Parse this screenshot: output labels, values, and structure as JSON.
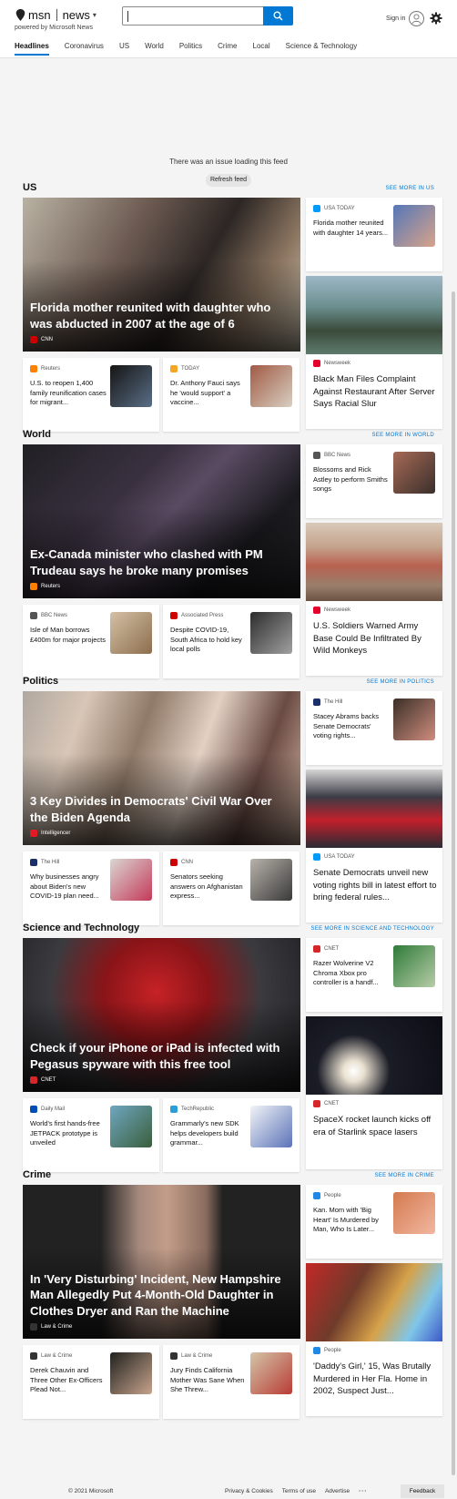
{
  "header": {
    "brand": "msn",
    "section": "news",
    "powered_by": "powered by Microsoft News",
    "search_value": "",
    "sign_in": "Sign in"
  },
  "nav": {
    "tabs": [
      {
        "label": "Headlines",
        "active": true
      },
      {
        "label": "Coronavirus"
      },
      {
        "label": "US"
      },
      {
        "label": "World"
      },
      {
        "label": "Politics"
      },
      {
        "label": "Crime"
      },
      {
        "label": "Local"
      },
      {
        "label": "Science & Technology"
      }
    ]
  },
  "feed_error": {
    "message": "There was an issue loading this feed",
    "refresh_label": "Refresh feed"
  },
  "sections": [
    {
      "title": "US",
      "see_more": "SEE MORE IN US",
      "hero": {
        "title": "Florida mother reunited with daughter who was abducted in 2007 at the age of 6",
        "source": "CNN"
      },
      "small_cards": [
        {
          "source": "Reuters",
          "title": "U.S. to reopen 1,400 family reunification cases for migrant..."
        },
        {
          "source": "TODAY",
          "title": "Dr. Anthony Fauci says he 'would support' a vaccine..."
        }
      ],
      "right_top": {
        "source": "USA TODAY",
        "title": "Florida mother reunited with daughter 14 years..."
      },
      "right_tall": {
        "source": "Newsweek",
        "title": "Black Man Files Complaint Against Restaurant After Server Says Racial Slur"
      }
    },
    {
      "title": "World",
      "see_more": "SEE MORE IN WORLD",
      "hero": {
        "title": "Ex-Canada minister who clashed with PM Trudeau says he broke many promises",
        "source": "Reuters"
      },
      "small_cards": [
        {
          "source": "BBC News",
          "title": "Isle of Man borrows £400m for major projects"
        },
        {
          "source": "Associated Press",
          "title": "Despite COVID-19, South Africa to hold key local polls"
        }
      ],
      "right_top": {
        "source": "BBC News",
        "title": "Blossoms and Rick Astley to perform Smiths songs"
      },
      "right_tall": {
        "source": "Newsweek",
        "title": "U.S. Soldiers Warned Army Base Could Be Infiltrated By Wild Monkeys"
      }
    },
    {
      "title": "Politics",
      "see_more": "SEE MORE IN POLITICS",
      "hero": {
        "title": "3 Key Divides in Democrats' Civil War Over the Biden Agenda",
        "source": "Intelligencer"
      },
      "small_cards": [
        {
          "source": "The Hill",
          "title": "Why businesses angry about Biden's new COVID-19 plan need..."
        },
        {
          "source": "CNN",
          "title": "Senators seeking answers on Afghanistan express..."
        }
      ],
      "right_top": {
        "source": "The Hill",
        "title": "Stacey Abrams backs Senate Democrats' voting rights..."
      },
      "right_tall": {
        "source": "USA TODAY",
        "title": "Senate Democrats unveil new voting rights bill in latest effort to bring federal rules..."
      }
    },
    {
      "title": "Science and Technology",
      "see_more": "SEE MORE IN SCIENCE AND TECHNOLOGY",
      "hero": {
        "title": "Check if your iPhone or iPad is infected with Pegasus spyware with this free tool",
        "source": "CNET"
      },
      "small_cards": [
        {
          "source": "Daily Mail",
          "title": "World's first hands-free JETPACK prototype is unveiled"
        },
        {
          "source": "TechRepublic",
          "title": "Grammarly's new SDK helps developers build grammar..."
        }
      ],
      "right_top": {
        "source": "CNET",
        "title": "Razer Wolverine V2 Chroma Xbox pro controller is a handf..."
      },
      "right_tall": {
        "source": "CNET",
        "title": "SpaceX rocket launch kicks off era of Starlink space lasers"
      }
    },
    {
      "title": "Crime",
      "see_more": "SEE MORE IN CRIME",
      "hero": {
        "title": "In 'Very Disturbing' Incident, New Hampshire Man Allegedly Put 4-Month-Old Daughter in Clothes Dryer and Ran the Machine",
        "source": "Law & Crime"
      },
      "small_cards": [
        {
          "source": "Law & Crime",
          "title": "Derek Chauvin and Three Other Ex-Officers Plead Not..."
        },
        {
          "source": "Law & Crime",
          "title": "Jury Finds California Mother Was Sane When She Threw..."
        }
      ],
      "right_top": {
        "source": "People",
        "title": "Kan. Mom with 'Big Heart' Is Murdered by Man, Who Is Later..."
      },
      "right_tall": {
        "source": "People",
        "title": "'Daddy's Girl,' 15, Was Brutally Murdered in Her Fla. Home in 2002, Suspect Just..."
      }
    }
  ],
  "footer": {
    "copyright": "© 2021 Microsoft",
    "links": [
      "Privacy & Cookies",
      "Terms of use",
      "Advertise"
    ],
    "more": "···",
    "feedback": "Feedback"
  },
  "colors": {
    "accent": "#0078d4",
    "background": "#f4f4f4"
  }
}
